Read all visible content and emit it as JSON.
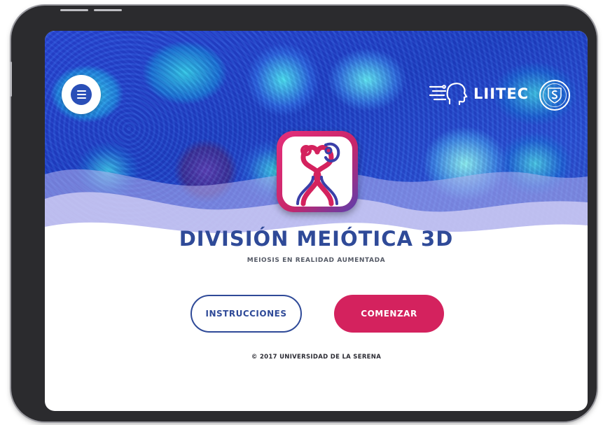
{
  "app": {
    "title": "DIVISIÓN MEIÓTICA 3D",
    "subtitle": "MEIOSIS EN REALIDAD AUMENTADA",
    "copyright": "© 2017 UNIVERSIDAD DE LA SERENA"
  },
  "header": {
    "menu_icon": "hamburger-menu-icon",
    "lab_logo_text": "LIITEC",
    "lab_logo_icon": "ai-head-circuit-icon",
    "university_seal_icon": "university-seal-icon"
  },
  "buttons": {
    "instructions_label": "INSTRUCCIONES",
    "start_label": "COMENZAR"
  },
  "colors": {
    "primary_blue": "#2f4a98",
    "accent_pink": "#d4225e",
    "hero_blue": "#2846d8"
  }
}
